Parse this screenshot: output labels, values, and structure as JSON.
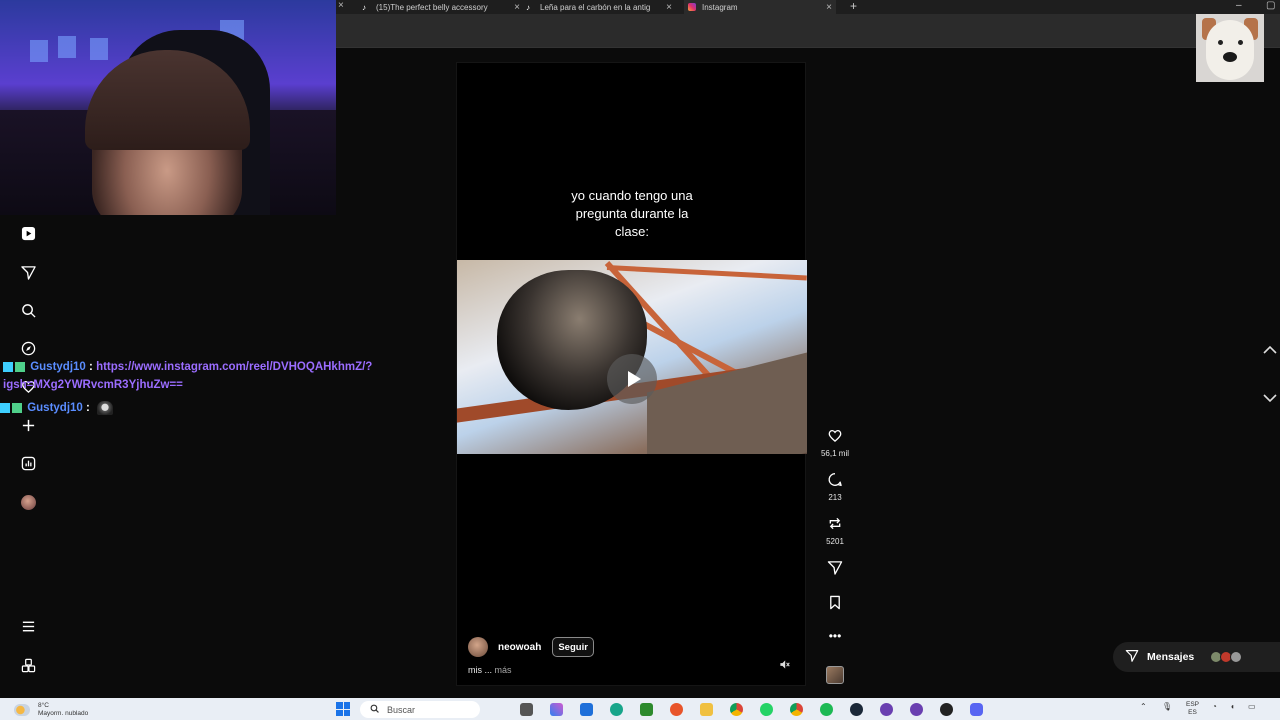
{
  "browser": {
    "tabs": [
      {
        "title": "(15)The perfect belly accessory"
      },
      {
        "title": "Leña para el carbón en la antig"
      },
      {
        "title": "Instagram"
      }
    ],
    "new_tab_label": "+",
    "close_label": "×"
  },
  "sidebar": {
    "items": [
      {
        "icon": "reels-icon"
      },
      {
        "icon": "send-icon"
      },
      {
        "icon": "search-icon"
      },
      {
        "icon": "explore-icon"
      },
      {
        "icon": "heart-icon"
      },
      {
        "icon": "create-icon"
      },
      {
        "icon": "dashboard-icon"
      },
      {
        "icon": "profile-icon"
      },
      {
        "icon": "menu-icon"
      },
      {
        "icon": "more-apps-icon"
      }
    ]
  },
  "chat": {
    "messages": [
      {
        "user": "Gustydj10",
        "separator": ":",
        "text_line1": "https://www.instagram.com/reel/DVHOQAHkhmZ/?",
        "text_line2": "igsh=MXg2YWRvcmR3YjhuZw=="
      },
      {
        "user": "Gustydj10",
        "separator": ":"
      }
    ]
  },
  "reel": {
    "caption_line1": "yo cuando tengo una",
    "caption_line2": "pregunta durante la",
    "caption_line3": "clase:",
    "author": "neowoah",
    "follow_label": "Seguir",
    "description": "mis ...",
    "more_label": "más"
  },
  "actions": {
    "likes": "56,1 mil",
    "comments": "213",
    "reposts": "5201"
  },
  "messages_pill": {
    "label": "Mensajes"
  },
  "taskbar": {
    "weather_temp": "8°C",
    "weather_desc": "Mayorm. nublado",
    "search_placeholder": "Buscar",
    "lang_line1": "ESP",
    "lang_line2": "ES"
  }
}
